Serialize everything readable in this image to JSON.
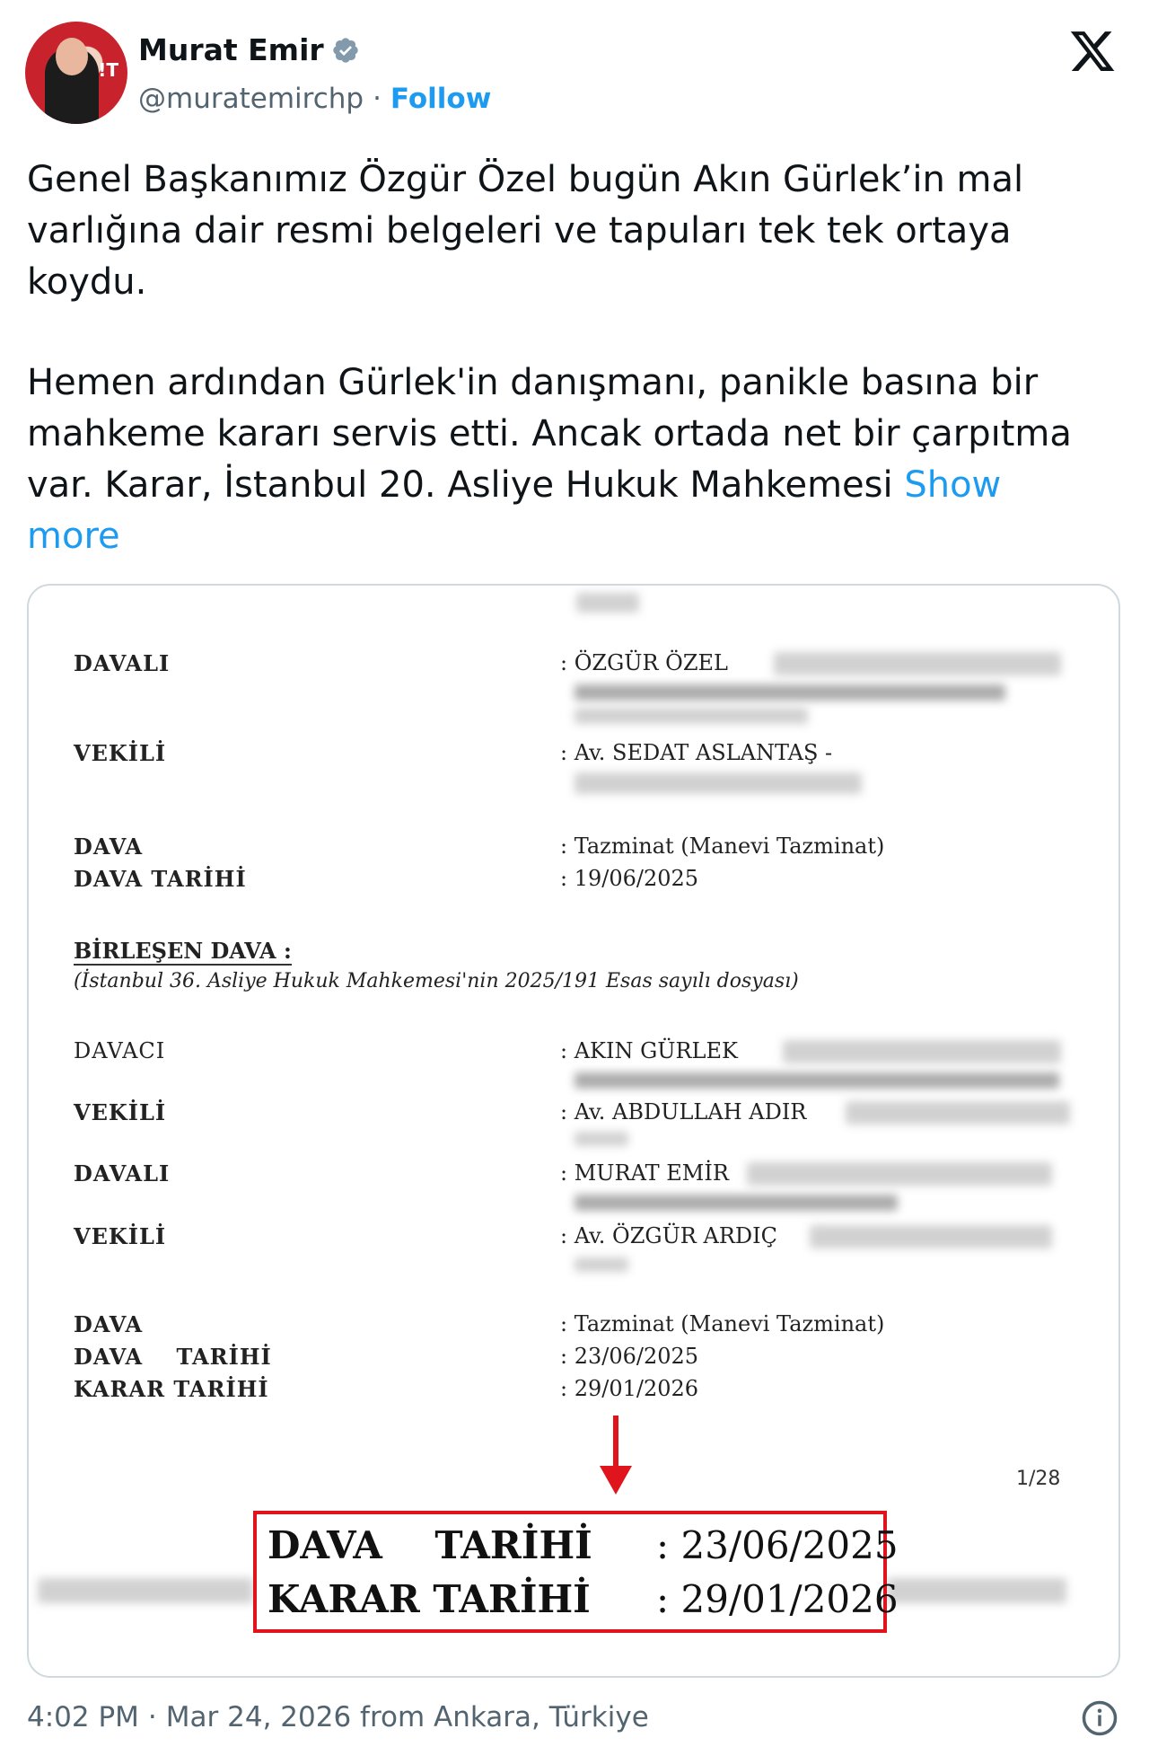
{
  "author": {
    "name": "Murat Emir",
    "handle": "@muratemirchp",
    "separator": "·",
    "follow_label": "Follow"
  },
  "tweet": {
    "paragraph1": "Genel Başkanımız Özgür Özel bugün Akın Gürlek’in mal varlığına dair resmi belgeleri ve tapuları tek tek ortaya koydu.",
    "paragraph2": "Hemen ardından Gürlek'in danışmanı, panikle basına bir mahkeme kararı servis etti. Ancak ortada net bir çarpıtma var. Karar, İstanbul 20. Asliye Hukuk Mahkemesi",
    "show_more": "Show more"
  },
  "document": {
    "davali_1": {
      "label": "DAVALI",
      "value": ": ÖZGÜR ÖZEL"
    },
    "vekili_1": {
      "label": "VEKİLİ",
      "value": ": Av. SEDAT ASLANTAŞ -"
    },
    "dava_1": {
      "label": "DAVA",
      "value": ": Tazminat (Manevi Tazminat)"
    },
    "dava_tarihi_1": {
      "label": "DAVA TARİHİ",
      "value": ": 19/06/2025"
    },
    "birlesen": "BİRLEŞEN DAVA :",
    "birlesen_note": "(İstanbul 36. Asliye Hukuk Mahkemesi'nin 2025/191 Esas sayılı dosyası)",
    "davaci": {
      "label": "DAVACI",
      "value": ": AKIN GÜRLEK"
    },
    "vekili_2": {
      "label": "VEKİLİ",
      "value": ": Av. ABDULLAH ADIR"
    },
    "davali_2": {
      "label": "DAVALI",
      "value": ": MURAT EMİR"
    },
    "vekili_3": {
      "label": "VEKİLİ",
      "value": ": Av. ÖZGÜR ARDIÇ"
    },
    "dava_2": {
      "label": "DAVA",
      "value": ": Tazminat (Manevi Tazminat)"
    },
    "dava_tarihi_2": {
      "label": "DAVA    TARİHİ",
      "value": ": 23/06/2025"
    },
    "karar_tarihi": {
      "label": "KARAR TARİHİ",
      "value": ": 29/01/2026"
    },
    "page": "1/28",
    "callout": {
      "row1_label": "DAVA    TARİHİ",
      "row1_value": ": 23/06/2025",
      "row2_label": "KARAR TARİHİ",
      "row2_value": ": 29/01/2026"
    }
  },
  "footer": {
    "time": "4:02 PM",
    "separator": "·",
    "date_location": "Mar 24, 2026 from Ankara, Türkiye"
  },
  "colors": {
    "link": "#1d9bf0",
    "secondary_text": "#536471",
    "callout_border": "#e0141c",
    "verified_badge": "#829aab"
  },
  "icons": [
    "verified-badge-icon",
    "x-logo-icon",
    "info-icon",
    "red-down-arrow-icon"
  ]
}
